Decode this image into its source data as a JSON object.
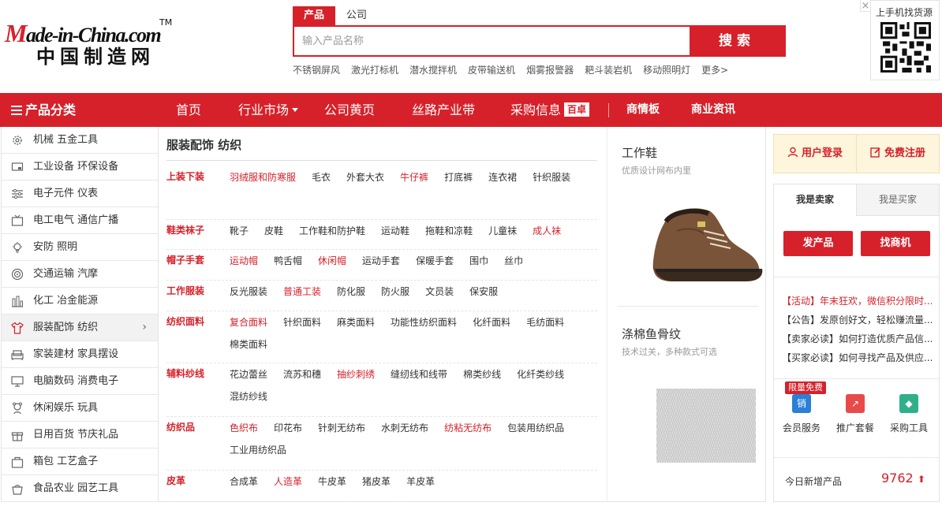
{
  "logo": {
    "en": "Made-in-China.com",
    "tm": "TM",
    "cn": "中国制造网"
  },
  "search": {
    "tabs": [
      "产品",
      "公司"
    ],
    "placeholder": "输入产品名称",
    "button": "搜索",
    "hot": [
      "不锈钢屏风",
      "激光打标机",
      "潜水搅拌机",
      "皮带输送机",
      "烟雾报警器",
      "耙斗装岩机",
      "移动照明灯",
      "更多>"
    ]
  },
  "qr": {
    "title": "上手机找货源",
    "close": "×"
  },
  "nav": {
    "category": "产品分类",
    "items": [
      "首页",
      "行业市场",
      "公司黄页",
      "丝路产业带",
      "采购信息",
      "商情板",
      "商业资讯"
    ],
    "badge": "百卓"
  },
  "sidebar": {
    "items": [
      {
        "label": "机械 五金工具",
        "icon": "gear-icon"
      },
      {
        "label": "工业设备 环保设备",
        "icon": "machine-icon"
      },
      {
        "label": "电子元件 仪表",
        "icon": "slider-icon"
      },
      {
        "label": "电工电气 通信广播",
        "icon": "tv-icon"
      },
      {
        "label": "安防 照明",
        "icon": "bulb-icon"
      },
      {
        "label": "交通运输 汽摩",
        "icon": "wheel-icon"
      },
      {
        "label": "化工 冶金能源",
        "icon": "chart-icon"
      },
      {
        "label": "服装配饰 纺织",
        "icon": "shirt-icon"
      },
      {
        "label": "家装建材 家具摆设",
        "icon": "sofa-icon"
      },
      {
        "label": "电脑数码 消费电子",
        "icon": "monitor-icon"
      },
      {
        "label": "休闲娱乐 玩具",
        "icon": "toy-icon"
      },
      {
        "label": "日用百货 节庆礼品",
        "icon": "gift-icon"
      },
      {
        "label": "箱包 工艺盒子",
        "icon": "bag-icon"
      },
      {
        "label": "食品农业 园艺工具",
        "icon": "pot-icon"
      }
    ],
    "arrow": "›"
  },
  "main": {
    "title": "服装配饰 纺织",
    "rows": [
      {
        "label": "上装下装",
        "items": [
          {
            "t": "羽绒服和防寒服",
            "hot": true
          },
          {
            "t": "毛衣"
          },
          {
            "t": "外套大衣"
          },
          {
            "t": "牛仔裤",
            "hot": true
          },
          {
            "t": "打底裤"
          },
          {
            "t": "连衣裙"
          },
          {
            "t": "针织服装"
          }
        ]
      },
      {
        "label": "鞋类袜子",
        "items": [
          {
            "t": "靴子"
          },
          {
            "t": "皮鞋"
          },
          {
            "t": "工作鞋和防护鞋"
          },
          {
            "t": "运动鞋"
          },
          {
            "t": "拖鞋和凉鞋"
          },
          {
            "t": "儿童袜"
          },
          {
            "t": "成人袜",
            "hot": true
          }
        ]
      },
      {
        "label": "帽子手套",
        "items": [
          {
            "t": "运动帽",
            "hot": true
          },
          {
            "t": "鸭舌帽"
          },
          {
            "t": "休闲帽",
            "hot": true
          },
          {
            "t": "运动手套"
          },
          {
            "t": "保暖手套"
          },
          {
            "t": "围巾"
          },
          {
            "t": "丝巾"
          }
        ]
      },
      {
        "label": "工作服装",
        "items": [
          {
            "t": "反光服装"
          },
          {
            "t": "普通工装",
            "hot": true
          },
          {
            "t": "防化服"
          },
          {
            "t": "防火服"
          },
          {
            "t": "文员装"
          },
          {
            "t": "保安服"
          }
        ]
      },
      {
        "label": "纺织面料",
        "items": [
          {
            "t": "复合面料",
            "hot": true
          },
          {
            "t": "针织面料"
          },
          {
            "t": "麻类面料"
          },
          {
            "t": "功能性纺织面料"
          },
          {
            "t": "化纤面料"
          },
          {
            "t": "毛纺面料"
          },
          {
            "t": "棉类面料"
          }
        ]
      },
      {
        "label": "辅料纱线",
        "items": [
          {
            "t": "花边蕾丝"
          },
          {
            "t": "流苏和穗"
          },
          {
            "t": "抽纱刺绣",
            "hot": true
          },
          {
            "t": "缝纫线和线带"
          },
          {
            "t": "棉类纱线"
          },
          {
            "t": "化纤类纱线"
          },
          {
            "t": "混纺纱线"
          }
        ]
      },
      {
        "label": "纺织品",
        "items": [
          {
            "t": "色织布",
            "hot": true
          },
          {
            "t": "印花布"
          },
          {
            "t": "针刺无纺布"
          },
          {
            "t": "水刺无纺布"
          },
          {
            "t": "纺粘无纺布",
            "hot": true
          },
          {
            "t": "包装用纺织品"
          },
          {
            "t": "工业用纺织品"
          }
        ]
      },
      {
        "label": "皮革",
        "items": [
          {
            "t": "合成革"
          },
          {
            "t": "人造革",
            "hot": true
          },
          {
            "t": "牛皮革"
          },
          {
            "t": "猪皮革"
          },
          {
            "t": "羊皮革"
          }
        ]
      }
    ]
  },
  "promo": [
    {
      "title": "工作鞋",
      "sub": "优质设计网布内里"
    },
    {
      "title": "涤棉鱼骨纹",
      "sub": "技术过关，多种款式可选"
    }
  ],
  "right": {
    "login": "用户登录",
    "register": "免费注册",
    "tabs": [
      "我是卖家",
      "我是买家"
    ],
    "buttons": [
      "发产品",
      "找商机"
    ],
    "news": [
      {
        "tag": "【活动】",
        "text": "年末狂欢，微信积分限时...",
        "hot": true
      },
      {
        "tag": "【公告】",
        "text": "发原创好文，轻松赚流量..."
      },
      {
        "tag": "【卖家必读】",
        "text": "如何打造优质产品信..."
      },
      {
        "tag": "【买家必读】",
        "text": "如何寻找产品及供应..."
      }
    ],
    "free_badge": "限量免费",
    "services": [
      {
        "label": "会员服务",
        "icon": "销",
        "color": "#2b7fd6"
      },
      {
        "label": "推广套餐",
        "icon": "↗",
        "color": "#e84a4a"
      },
      {
        "label": "采购工具",
        "icon": "◆",
        "color": "#2fb08a"
      }
    ],
    "today_label": "今日新增产品",
    "today_count": "9762",
    "up_arrow": "⬆"
  }
}
